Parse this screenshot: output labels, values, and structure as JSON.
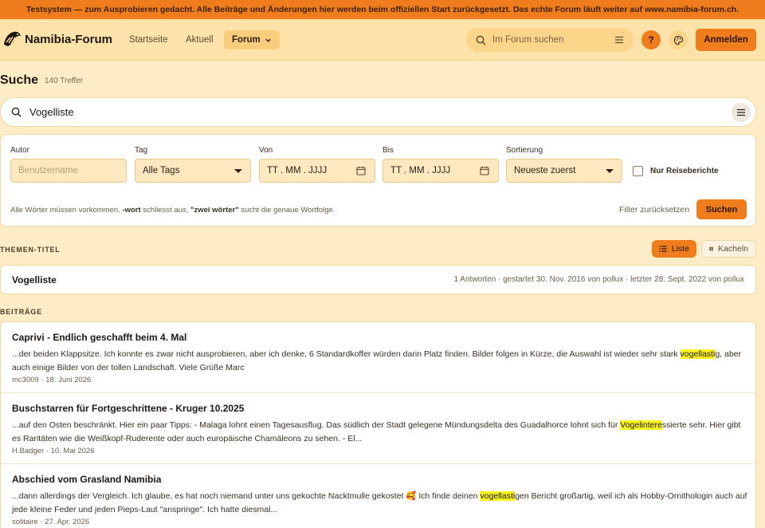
{
  "banner": {
    "text": "Testsystem — zum Ausprobieren gedacht. Alle Beiträge und Änderungen hier werden beim offiziellen Start zurückgesetzt. Das echte Forum läuft weiter auf www.namibia-forum.ch."
  },
  "header": {
    "logo_text": "Namibia-Forum",
    "nav": [
      {
        "label": "Startseite"
      },
      {
        "label": "Aktuell"
      },
      {
        "label": "Forum"
      }
    ],
    "search_placeholder": "Im Forum suchen",
    "help_label": "?",
    "login_label": "Anmelden"
  },
  "page": {
    "title": "Suche",
    "hit_count": "140 Treffer"
  },
  "search": {
    "value": "Vogelliste"
  },
  "filters": {
    "author": {
      "label": "Autor",
      "placeholder": "Benutzername"
    },
    "tag": {
      "label": "Tag",
      "value": "Alle Tags"
    },
    "from": {
      "label": "Von",
      "value": "TT . MM . JJJJ"
    },
    "to": {
      "label": "Bis",
      "value": "TT . MM . JJJJ"
    },
    "sort": {
      "label": "Sortierung",
      "value": "Neueste zuerst"
    },
    "only_reports": "Nur Reiseberichte",
    "hint_prefix": "Alle Wörter müssen vorkommen. ",
    "hint_minus": "-wort",
    "hint_middle": " schliesst aus, ",
    "hint_quote": "\"zwei wörter\"",
    "hint_suffix": " sucht die genaue Wortfolge.",
    "reset_label": "Filter zurücksetzen",
    "submit_label": "Suchen"
  },
  "topics_section": {
    "label": "THEMEN-TITEL",
    "view_list": "Liste",
    "view_tiles": "Kacheln",
    "items": [
      {
        "title": "Vogelliste",
        "meta": "1 Antworten · gestartet 30. Nov. 2016 von pollux · letzter 28. Sept. 2022 von pollux"
      }
    ]
  },
  "posts_section": {
    "label": "BEITRÄGE",
    "items": [
      {
        "title": "Caprivi - Endlich geschafft beim 4. Mal",
        "pre": "...der beiden Klappsitze. Ich konnte es zwar nicht ausprobieren, aber ich denke, 6 Standardkoffer würden darin Platz finden. Bilder folgen in Kürze, die Auswahl ist wieder sehr stark ",
        "hl": "vogellasti",
        "post": "g, aber auch einige Bilder von der tollen Landschaft. Viele Grüße Marc",
        "meta": "mc3009 · 18. Juni 2026"
      },
      {
        "title": "Buschstarren für Fortgeschrittene - Kruger 10.2025",
        "pre": "...auf den Osten beschränkt. Hier ein paar Tipps: - Malaga lohnt einen Tagesausflug. Das südlich der Stadt gelegene Mündungsdelta des Guadalhorce lohnt sich für ",
        "hl": "Vogelintere",
        "post": "ssierte sehr. Hier gibt es Raritäten wie die Weißkopf-Ruderente oder auch europäische Chamäleons zu sehen. - El...",
        "meta": "H.Badger · 10. Mai 2026"
      },
      {
        "title": "Abschied vom Grasland Namibia",
        "pre": "...dann allerdings der Vergleich. Ich glaube, es hat noch niemand unter uns gekochte Nacktmulle gekostet 🥰 Ich finde deinen ",
        "hl": "vogellasti",
        "post": "gen Bericht großartig, weil ich als Hobby-Ornithologin auch auf jede kleine Feder und jeden Pieps-Laut \"anspringe\". Ich hatte diesmal...",
        "meta": "solitaire · 27. Apr. 2026"
      }
    ]
  },
  "colors": {
    "accent": "#f07d1c",
    "background": "#fdecc6",
    "highlight": "#fbf41e"
  }
}
